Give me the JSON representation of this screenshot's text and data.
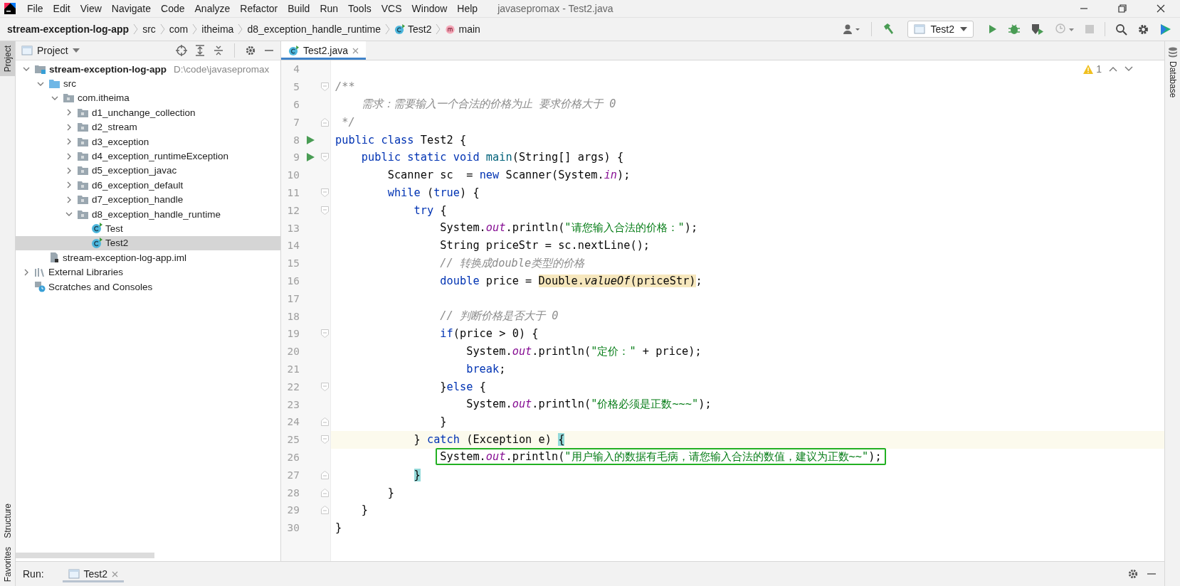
{
  "menu": [
    "File",
    "Edit",
    "View",
    "Navigate",
    "Code",
    "Analyze",
    "Refactor",
    "Build",
    "Run",
    "Tools",
    "VCS",
    "Window",
    "Help"
  ],
  "window": {
    "title": "javasepromax - Test2.java"
  },
  "breadcrumbs": [
    {
      "label": "stream-exception-log-app",
      "kind": "project"
    },
    {
      "label": "src",
      "kind": "plain"
    },
    {
      "label": "com",
      "kind": "plain"
    },
    {
      "label": "itheima",
      "kind": "plain"
    },
    {
      "label": "d8_exception_handle_runtime",
      "kind": "plain"
    },
    {
      "label": "Test2",
      "kind": "class"
    },
    {
      "label": "main",
      "kind": "method"
    }
  ],
  "run_config": {
    "label": "Test2"
  },
  "left_strip": [
    {
      "label": "Project",
      "selected": true
    },
    {
      "label": "Structure",
      "selected": false
    },
    {
      "label": "Favorites",
      "selected": false
    }
  ],
  "right_strip": [
    {
      "label": "Database"
    }
  ],
  "project_panel": {
    "title": "Project"
  },
  "project_tree": [
    {
      "label": "stream-exception-log-app",
      "kind": "module",
      "path": "D:\\code\\javasepromax",
      "expanded": true,
      "selected": false,
      "children": [
        {
          "label": "src",
          "kind": "source",
          "expanded": true,
          "selected": false,
          "children": [
            {
              "label": "com.itheima",
              "kind": "package",
              "expanded": true,
              "selected": false,
              "children": [
                {
                  "label": "d1_unchange_collection",
                  "kind": "package",
                  "expanded": false,
                  "selected": false
                },
                {
                  "label": "d2_stream",
                  "kind": "package",
                  "expanded": false,
                  "selected": false
                },
                {
                  "label": "d3_exception",
                  "kind": "package",
                  "expanded": false,
                  "selected": false
                },
                {
                  "label": "d4_exception_runtimeException",
                  "kind": "package",
                  "expanded": false,
                  "selected": false
                },
                {
                  "label": "d5_exception_javac",
                  "kind": "package",
                  "expanded": false,
                  "selected": false
                },
                {
                  "label": "d6_exception_default",
                  "kind": "package",
                  "expanded": false,
                  "selected": false
                },
                {
                  "label": "d7_exception_handle",
                  "kind": "package",
                  "expanded": false,
                  "selected": false
                },
                {
                  "label": "d8_exception_handle_runtime",
                  "kind": "package",
                  "expanded": true,
                  "selected": false,
                  "children": [
                    {
                      "label": "Test",
                      "kind": "class",
                      "selected": false
                    },
                    {
                      "label": "Test2",
                      "kind": "class",
                      "selected": true
                    }
                  ]
                }
              ]
            }
          ]
        },
        {
          "label": "stream-exception-log-app.iml",
          "kind": "file",
          "selected": false
        }
      ]
    },
    {
      "label": "External Libraries",
      "kind": "libraries",
      "expanded": false,
      "selected": false
    },
    {
      "label": "Scratches and Consoles",
      "kind": "scratches",
      "selected": false
    }
  ],
  "editor_tabs": [
    {
      "label": "Test2.java",
      "selected": true
    }
  ],
  "inspections": {
    "warnings": "1"
  },
  "code_lines": [
    {
      "number": "4"
    },
    {
      "number": "5",
      "fold_start": true,
      "segments": [
        {
          "kind": "doc",
          "text": "/**"
        }
      ]
    },
    {
      "number": "6",
      "segments": [
        {
          "kind": "doc",
          "text": "    需求：需要输入一个合法的价格为止 要求价格大于 0"
        }
      ]
    },
    {
      "number": "7",
      "fold_end": true,
      "segments": [
        {
          "kind": "doc",
          "text": " */"
        }
      ]
    },
    {
      "number": "8",
      "run": true,
      "segments": [
        {
          "kind": "keyword",
          "text": "public class"
        },
        {
          "kind": "plain",
          "text": " Test2 {"
        }
      ]
    },
    {
      "number": "9",
      "run": true,
      "fold_start": true,
      "segments": [
        {
          "kind": "keyword",
          "text": "    public static void"
        },
        {
          "kind": "method",
          "text": " main"
        },
        {
          "kind": "plain",
          "text": "(String[] args) {"
        }
      ]
    },
    {
      "number": "10",
      "segments": [
        {
          "kind": "plain",
          "text": "        Scanner sc  = "
        },
        {
          "kind": "keyword",
          "text": "new"
        },
        {
          "kind": "plain",
          "text": " Scanner(System."
        },
        {
          "kind": "static",
          "text": "in"
        },
        {
          "kind": "plain",
          "text": ");"
        }
      ]
    },
    {
      "number": "11",
      "fold_start": true,
      "segments": [
        {
          "kind": "keyword",
          "text": "        while"
        },
        {
          "kind": "plain",
          "text": " ("
        },
        {
          "kind": "keyword",
          "text": "true"
        },
        {
          "kind": "plain",
          "text": ") {"
        }
      ]
    },
    {
      "number": "12",
      "fold_start": true,
      "segments": [
        {
          "kind": "keyword",
          "text": "            try"
        },
        {
          "kind": "plain",
          "text": " {"
        }
      ]
    },
    {
      "number": "13",
      "segments": [
        {
          "kind": "plain",
          "text": "                System."
        },
        {
          "kind": "static",
          "text": "out"
        },
        {
          "kind": "plain",
          "text": ".println("
        },
        {
          "kind": "string",
          "text": "\"请您输入合法的价格：\""
        },
        {
          "kind": "plain",
          "text": ");"
        }
      ]
    },
    {
      "number": "14",
      "segments": [
        {
          "kind": "plain",
          "text": "                String priceStr = sc.nextLine();"
        }
      ]
    },
    {
      "number": "15",
      "segments": [
        {
          "kind": "comment",
          "text": "                // 转换成double类型的价格"
        }
      ]
    },
    {
      "number": "16",
      "segments": [
        {
          "kind": "keyword",
          "text": "                double"
        },
        {
          "kind": "plain",
          "text": " price = "
        },
        {
          "kind": "plain",
          "text": "Double.",
          "highlighted": true
        },
        {
          "kind": "static_method",
          "text": "valueOf",
          "highlighted": true
        },
        {
          "kind": "plain",
          "text": "(priceStr)",
          "highlighted": true
        },
        {
          "kind": "plain",
          "text": ";"
        }
      ]
    },
    {
      "number": "17"
    },
    {
      "number": "18",
      "segments": [
        {
          "kind": "comment",
          "text": "                // 判断价格是否大于 0"
        }
      ]
    },
    {
      "number": "19",
      "fold_start": true,
      "segments": [
        {
          "kind": "keyword",
          "text": "                if"
        },
        {
          "kind": "plain",
          "text": "(price > 0) {"
        }
      ]
    },
    {
      "number": "20",
      "segments": [
        {
          "kind": "plain",
          "text": "                    System."
        },
        {
          "kind": "static",
          "text": "out"
        },
        {
          "kind": "plain",
          "text": ".println("
        },
        {
          "kind": "string",
          "text": "\"定价：\""
        },
        {
          "kind": "plain",
          "text": " + price);"
        }
      ]
    },
    {
      "number": "21",
      "segments": [
        {
          "kind": "keyword",
          "text": "                    break"
        },
        {
          "kind": "plain",
          "text": ";"
        }
      ]
    },
    {
      "number": "22",
      "fold_start": true,
      "segments": [
        {
          "kind": "plain",
          "text": "                }"
        },
        {
          "kind": "keyword",
          "text": "else"
        },
        {
          "kind": "plain",
          "text": " {"
        }
      ]
    },
    {
      "number": "23",
      "segments": [
        {
          "kind": "plain",
          "text": "                    System."
        },
        {
          "kind": "static",
          "text": "out"
        },
        {
          "kind": "plain",
          "text": ".println("
        },
        {
          "kind": "string",
          "text": "\"价格必须是正数~~~\""
        },
        {
          "kind": "plain",
          "text": ");"
        }
      ]
    },
    {
      "number": "24",
      "fold_end": true,
      "segments": [
        {
          "kind": "plain",
          "text": "                }"
        }
      ]
    },
    {
      "number": "25",
      "fold_start": true,
      "current": true,
      "segments": [
        {
          "kind": "plain",
          "text": "            } "
        },
        {
          "kind": "keyword",
          "text": "catch"
        },
        {
          "kind": "plain",
          "text": " (Exception e) "
        },
        {
          "kind": "plain",
          "text": "{",
          "matched": true
        }
      ]
    },
    {
      "number": "26",
      "boxed": true,
      "segments": [
        {
          "kind": "plain",
          "text": "                System."
        },
        {
          "kind": "static",
          "text": "out"
        },
        {
          "kind": "plain",
          "text": ".println("
        },
        {
          "kind": "string",
          "text": "\"用户输入的数据有毛病，请您输入合法的数值，建议为正数~~\""
        },
        {
          "kind": "plain",
          "text": ");"
        }
      ]
    },
    {
      "number": "27",
      "fold_end": true,
      "segments": [
        {
          "kind": "plain",
          "text": "            }",
          "matched": true
        }
      ]
    },
    {
      "number": "28",
      "fold_end": true,
      "segments": [
        {
          "kind": "plain",
          "text": "        }"
        }
      ]
    },
    {
      "number": "29",
      "fold_end": true,
      "segments": [
        {
          "kind": "plain",
          "text": "    }"
        }
      ]
    },
    {
      "number": "30",
      "segments": [
        {
          "kind": "plain",
          "text": "}"
        }
      ]
    }
  ],
  "run_bar": {
    "label": "Run:",
    "tabs": [
      {
        "label": "Test2",
        "selected": true
      }
    ]
  }
}
